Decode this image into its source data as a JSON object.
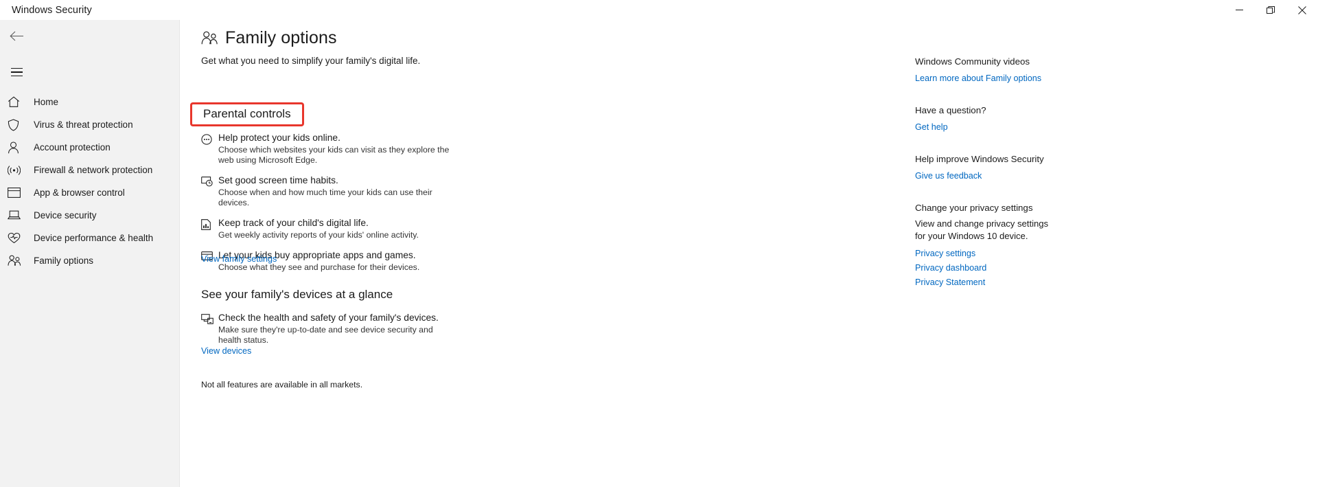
{
  "window": {
    "title": "Windows Security",
    "controls": [
      {
        "name": "minimize-button",
        "glyph": "minimize"
      },
      {
        "name": "maximize-button",
        "glyph": "maximize"
      },
      {
        "name": "close-button",
        "glyph": "close"
      }
    ]
  },
  "sidebar": {
    "back_label": "Back",
    "menu_label": "Open Navigation",
    "items": [
      {
        "label": "Home",
        "icon": "home-icon"
      },
      {
        "label": "Virus & threat protection",
        "icon": "shield-icon"
      },
      {
        "label": "Account protection",
        "icon": "person-icon"
      },
      {
        "label": "Firewall & network protection",
        "icon": "wifi-icon"
      },
      {
        "label": "App & browser control",
        "icon": "window-icon"
      },
      {
        "label": "Device security",
        "icon": "laptop-icon"
      },
      {
        "label": "Device performance & health",
        "icon": "heart-pulse-icon"
      },
      {
        "label": "Family options",
        "icon": "people-icon"
      }
    ]
  },
  "main": {
    "title": "Family options",
    "title_icon": "people-icon",
    "subtitle": "Get what you need to simplify your family's digital life.",
    "section1": {
      "title": "Parental controls",
      "highlight_color": "#e8362c",
      "features": [
        {
          "icon": "web-browser-icon",
          "title": "Help protect your kids online.",
          "desc": "Choose which websites your kids can visit as they explore the web using Microsoft Edge."
        },
        {
          "icon": "screen-time-icon",
          "title": "Set good screen time habits.",
          "desc": "Choose when and how much time your kids can use their devices."
        },
        {
          "icon": "activity-report-icon",
          "title": "Keep track of your child's digital life.",
          "desc": "Get weekly activity reports of your kids' online activity."
        },
        {
          "icon": "credit-card-icon",
          "title": "Let your kids buy appropriate apps and games.",
          "desc": "Choose what they see and purchase for their devices."
        }
      ],
      "link": "View family settings"
    },
    "section2": {
      "title": "See your family's devices at a glance",
      "features": [
        {
          "icon": "devices-icon",
          "title": "Check the health and safety of your family's devices.",
          "desc": "Make sure they're up-to-date and see device security and health status."
        }
      ],
      "link": "View devices"
    },
    "footnote": "Not all features are available in all markets."
  },
  "rail": {
    "groups": [
      {
        "head": "Windows Community videos",
        "links": [
          "Learn more about Family options"
        ]
      },
      {
        "head": "Have a question?",
        "links": [
          "Get help"
        ]
      },
      {
        "head": "Help improve Windows Security",
        "links": [
          "Give us feedback"
        ]
      },
      {
        "head": "Change your privacy settings",
        "body": "View and change privacy settings for your Windows 10 device.",
        "links": [
          "Privacy settings",
          "Privacy dashboard",
          "Privacy Statement"
        ]
      }
    ]
  },
  "colors": {
    "accent_link": "#0067c0",
    "highlight": "#e8362c",
    "sidebar_bg": "#f2f2f2"
  }
}
